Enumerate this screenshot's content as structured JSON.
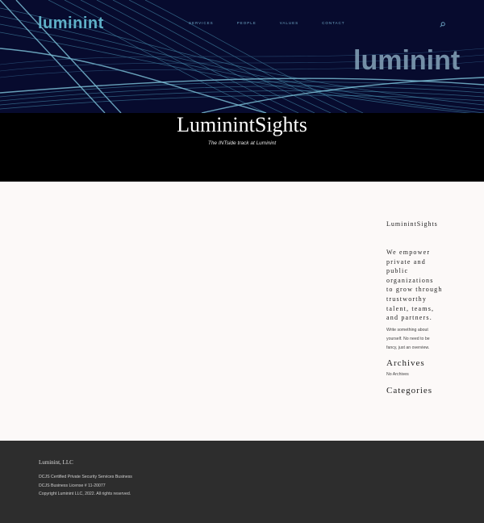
{
  "header": {
    "logo": "luminint",
    "nav": [
      "SERVICES",
      "PEOPLE",
      "VALUES",
      "CONTACT"
    ],
    "hero_brand": "luminint",
    "search_icon": "search-icon"
  },
  "title_band": {
    "title": "LuminintSights",
    "subtitle": "The INTside track at Luminint"
  },
  "sidebar": {
    "site_title": "LuminintSights",
    "tagline": "We empower private and public organizations to grow through trustworthy talent, teams, and partners.",
    "about": "Write something about yourself. No need to be fancy, just an overview.",
    "archives_heading": "Archives",
    "archives_empty": "No Archives",
    "categories_heading": "Categories"
  },
  "footer": {
    "brand": "Luminint, LLC",
    "line1": "DCJS Certified Private Security Services Business",
    "line2": "DCJS Business License # 11-20077",
    "line3": "Copyright Luminint LLC, 2022.  All rights reserved."
  },
  "colors": {
    "hero_bg": "#070b2e",
    "wave": "#5fb0c7",
    "band_bg": "#000000",
    "page_bg": "#fcf9f8",
    "footer_bg": "#2d2d2d"
  }
}
